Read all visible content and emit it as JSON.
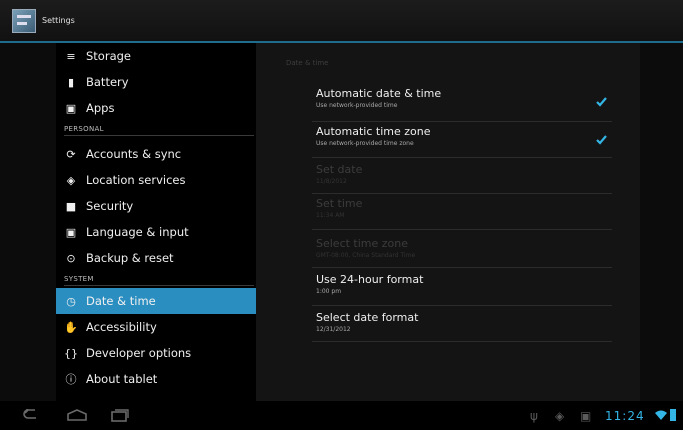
{
  "actionbar": {
    "title": "Settings"
  },
  "nav": {
    "items": [
      {
        "label": "Storage",
        "icon": "storage-icon",
        "glyph": "≡"
      },
      {
        "label": "Battery",
        "icon": "battery-icon",
        "glyph": "▮"
      },
      {
        "label": "Apps",
        "icon": "apps-icon",
        "glyph": "▣"
      },
      {
        "label": "Accounts & sync",
        "icon": "sync-icon",
        "glyph": "⟳"
      },
      {
        "label": "Location services",
        "icon": "location-icon",
        "glyph": "◈"
      },
      {
        "label": "Security",
        "icon": "lock-icon",
        "glyph": "■"
      },
      {
        "label": "Language & input",
        "icon": "keyboard-icon",
        "glyph": "▣"
      },
      {
        "label": "Backup & reset",
        "icon": "backup-icon",
        "glyph": "⊙"
      },
      {
        "label": "Date & time",
        "icon": "clock-icon",
        "glyph": "◷"
      },
      {
        "label": "Accessibility",
        "icon": "accessibility-icon",
        "glyph": "✋"
      },
      {
        "label": "Developer options",
        "icon": "developer-icon",
        "glyph": "{}"
      },
      {
        "label": "About tablet",
        "icon": "info-icon",
        "glyph": "ⓘ"
      }
    ],
    "headers": [
      "PERSONAL",
      "SYSTEM"
    ]
  },
  "detail": {
    "section_title": "Date & time",
    "rows": [
      {
        "title": "Automatic date & time",
        "summary": "Use network-provided time",
        "checked": true
      },
      {
        "title": "Automatic time zone",
        "summary": "Use network-provided time zone",
        "checked": true
      },
      {
        "title": "Set date",
        "summary": "11/8/2012",
        "disabled": true
      },
      {
        "title": "Set time",
        "summary": "11:34 AM",
        "disabled": true
      },
      {
        "title": "Select time zone",
        "summary": "GMT-08:00, China Standard Time",
        "disabled": true
      },
      {
        "title": "Use 24-hour format",
        "summary": "1:00 pm",
        "checked": false
      },
      {
        "title": "Select date format",
        "summary": "12/31/2012"
      }
    ]
  },
  "systembar": {
    "clock": "11:24"
  },
  "colors": {
    "accent": "#2a8ec1",
    "holo_blue": "#33b5e5"
  }
}
